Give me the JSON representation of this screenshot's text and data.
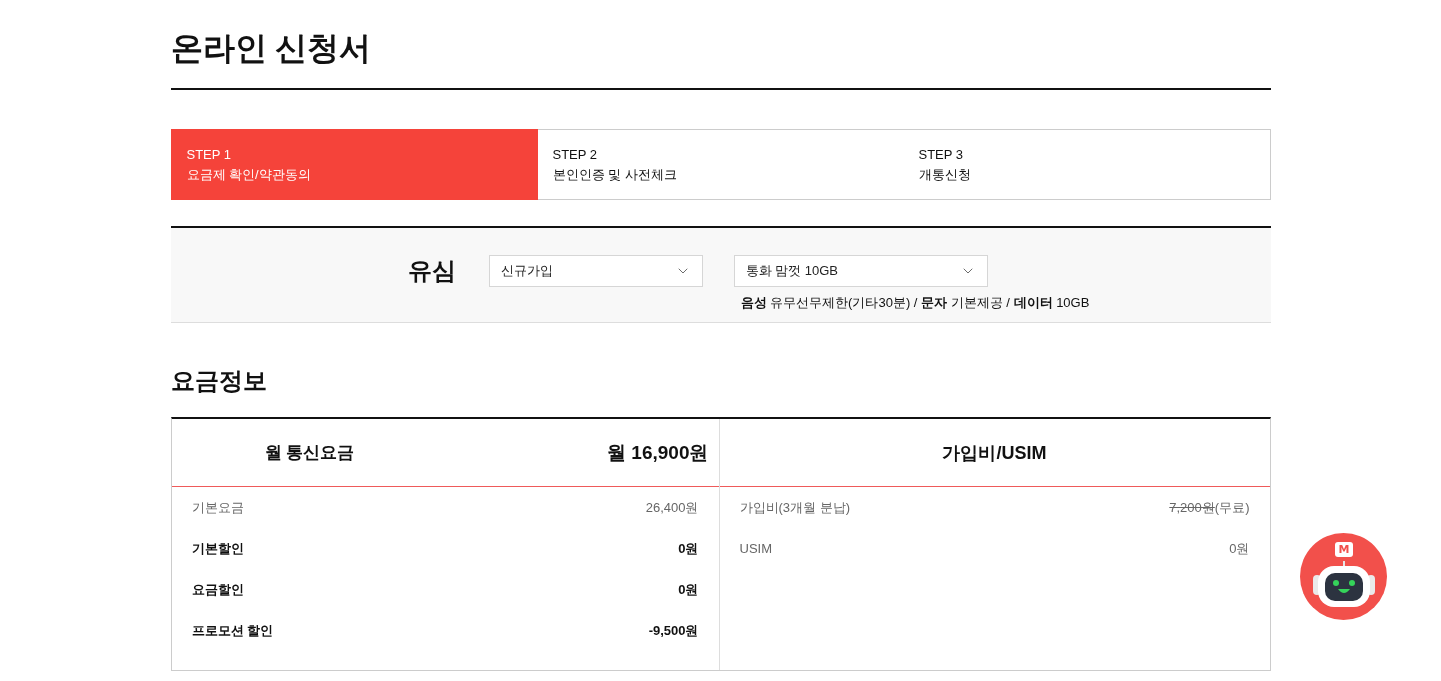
{
  "page_title": "온라인 신청서",
  "steps": [
    {
      "label": "STEP 1",
      "title": "요금제 확인/약관동의",
      "selected": true
    },
    {
      "label": "STEP 2",
      "title": "본인인증 및 사전체크",
      "selected": false
    },
    {
      "label": "STEP 3",
      "title": "개통신청",
      "selected": false
    }
  ],
  "plan_selector": {
    "label": "유심",
    "selects": [
      {
        "value": "신규가입"
      },
      {
        "value": "통화 맘껏 10GB"
      }
    ],
    "description": "**음성** 유무선무제한(기타30분) / **문자** 기본제공 / **데이터** 10GB"
  },
  "fee_info": {
    "title": "요금정보",
    "monthly": {
      "title": "월 통신요금",
      "total": "월 16,900원",
      "rows": [
        {
          "label": "기본요금",
          "value": "26,400원",
          "bold": false
        },
        {
          "label": "기본할인",
          "value": "0원",
          "bold": true
        },
        {
          "label": "요금할인",
          "value": "0원",
          "bold": true
        },
        {
          "label": "프로모션 할인",
          "value": "-9,500원",
          "bold": true
        }
      ]
    },
    "signup": {
      "title": "가입비/USIM",
      "rows": [
        {
          "label": "가입비(3개월 분납)",
          "value": "7,200원",
          "struck": true,
          "note": "(무료)"
        },
        {
          "label": "USIM",
          "value": "0원",
          "struck": false
        }
      ]
    }
  },
  "chatbot": {
    "badge": "M"
  }
}
